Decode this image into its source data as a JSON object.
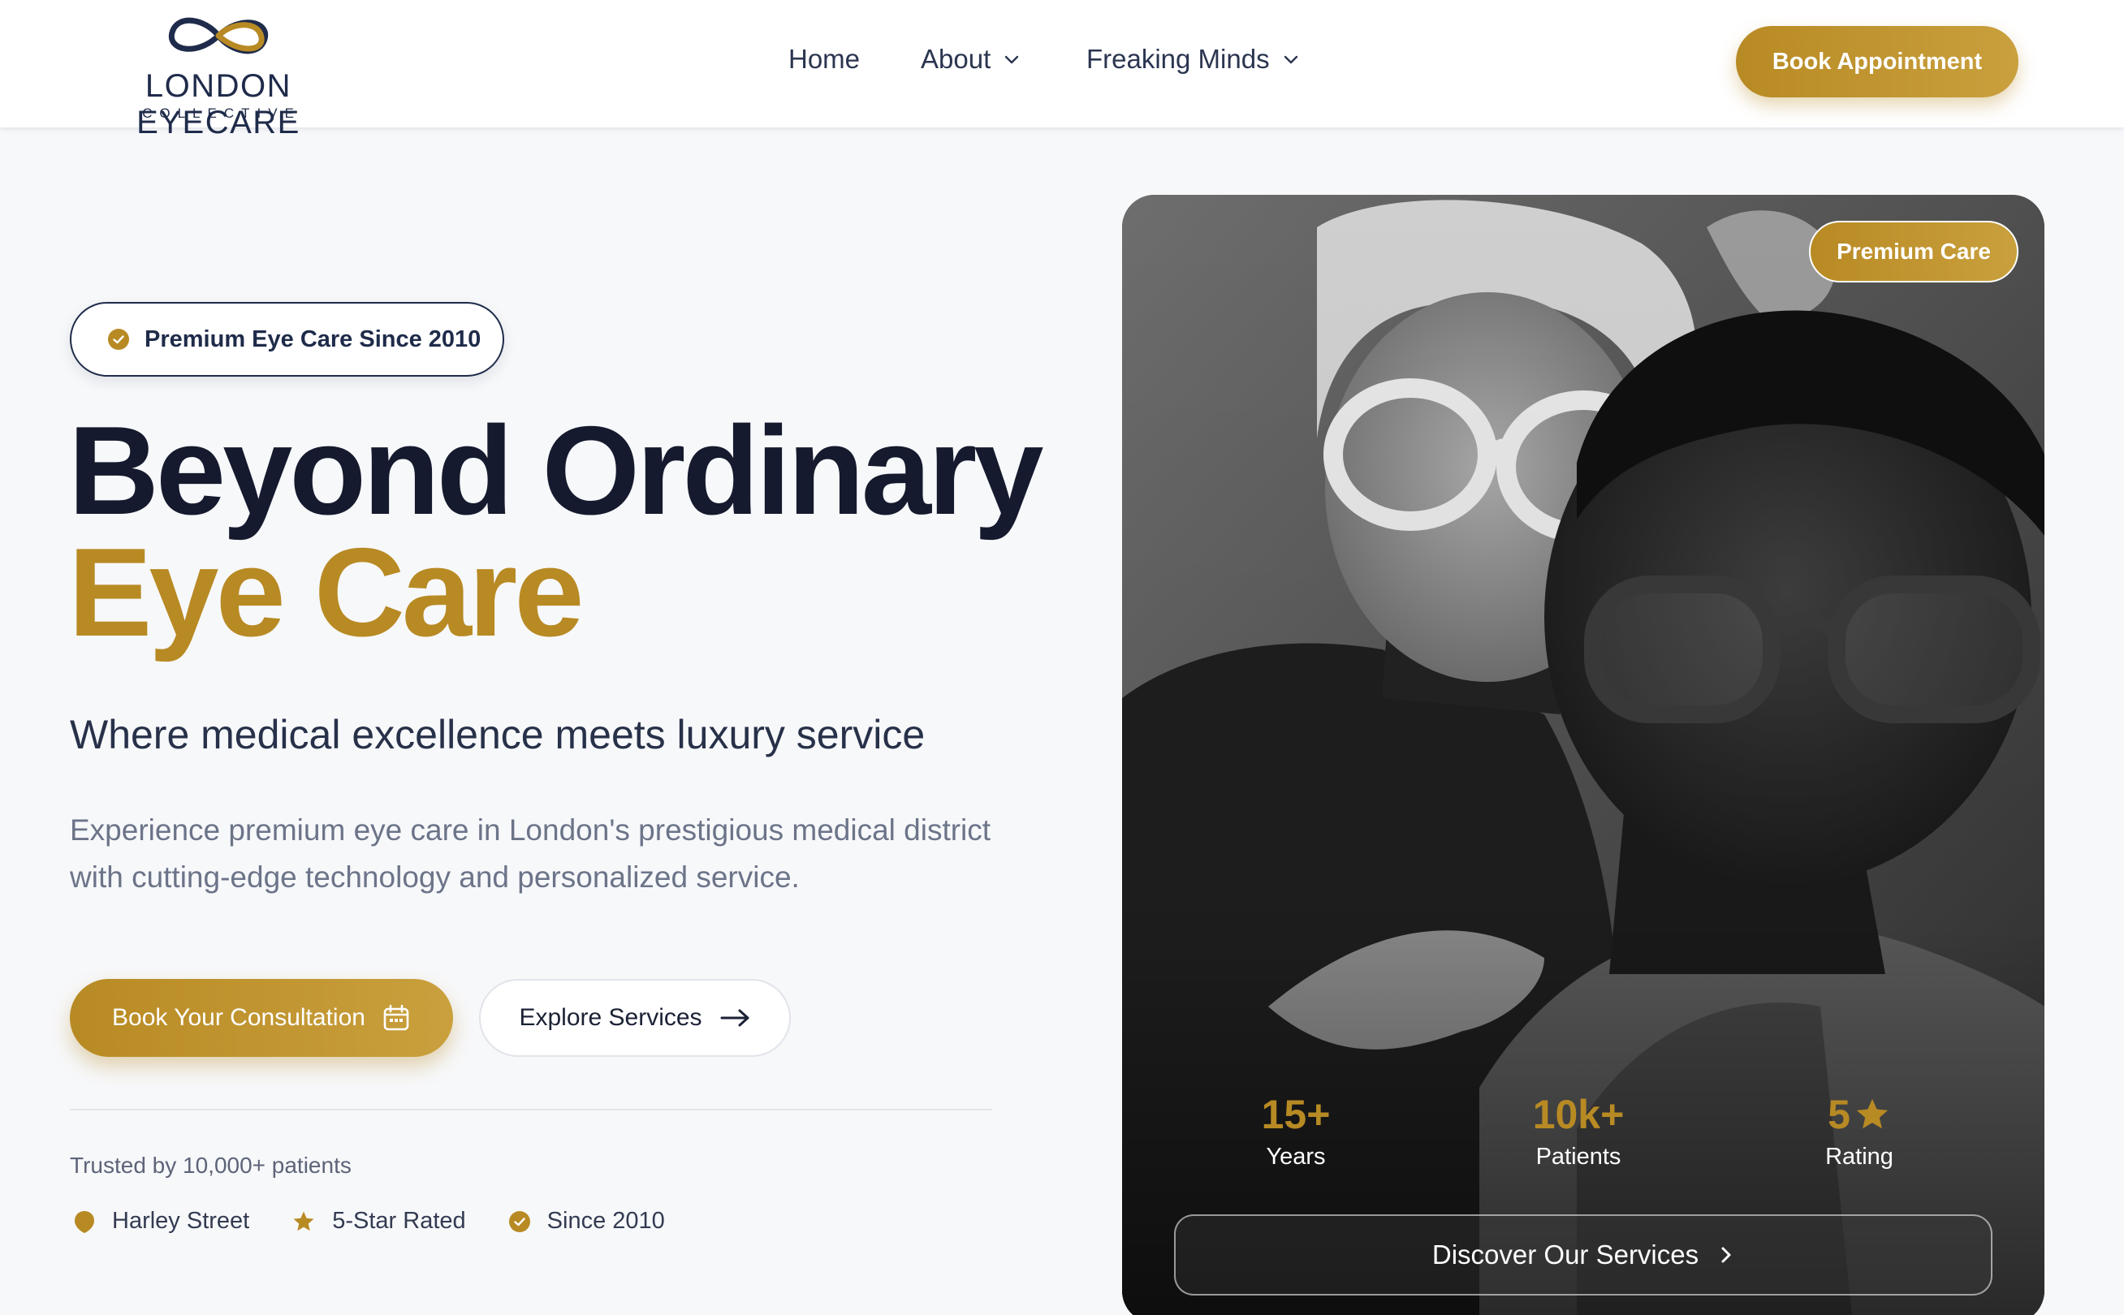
{
  "brand": {
    "name": "LONDON EYECARE",
    "tagline": "COLLECTIVE",
    "navy": "#1f2b4a",
    "gold": "#b88a24"
  },
  "nav": {
    "items": [
      {
        "label": "Home",
        "has_dropdown": false
      },
      {
        "label": "About",
        "has_dropdown": true
      },
      {
        "label": "Freaking Minds",
        "has_dropdown": true
      }
    ],
    "cta_label": "Book Appointment"
  },
  "hero": {
    "badge": "Premium Eye Care Since 2010",
    "title_line1": "Beyond Ordinary",
    "title_line2": "Eye Care",
    "subtitle": "Where medical excellence meets luxury service",
    "description": "Experience premium eye care in London's prestigious medical district with cutting-edge technology and personalized service.",
    "primary_cta": "Book Your Consultation",
    "secondary_cta": "Explore Services",
    "trusted_text": "Trusted by 10,000+ patients",
    "trust_badges": [
      {
        "label": "Harley Street",
        "icon": "location-pin-icon"
      },
      {
        "label": "5-Star Rated",
        "icon": "star-icon"
      },
      {
        "label": "Since 2010",
        "icon": "verified-badge-icon"
      }
    ]
  },
  "card": {
    "badge": "Premium Care",
    "stats": [
      {
        "value": "15+",
        "label": "Years"
      },
      {
        "value": "10k+",
        "label": "Patients"
      },
      {
        "value": "5",
        "label": "Rating",
        "icon": "star-icon"
      }
    ],
    "cta": "Discover Our Services"
  }
}
